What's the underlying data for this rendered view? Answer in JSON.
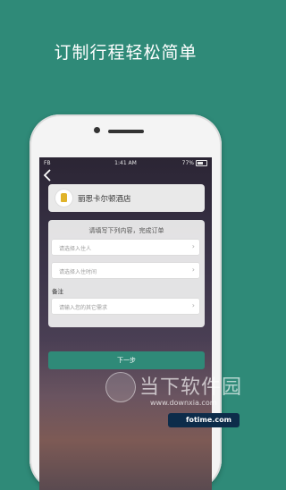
{
  "headline": "订制行程轻松简单",
  "status_bar": {
    "carrier": "FB",
    "time": "1:41 AM",
    "battery": "77%"
  },
  "hotel": {
    "name": "丽思卡尔顿酒店",
    "logo_icon": "hotel-logo-icon"
  },
  "form": {
    "title": "请填写下列内容，完成订单",
    "field_checkin_placeholder": "请选择入住人",
    "field_time_placeholder": "请选择入住时间",
    "remarks_label": "备注",
    "field_remarks_placeholder": "请输入您的其它需求"
  },
  "next_button": "下一步",
  "watermark": {
    "cn": "当下软件园",
    "site": "www.downxia.com",
    "brand": "fotime.com"
  },
  "colors": {
    "brand_green": "#2f8a78",
    "logo_gold": "#e0b32a"
  }
}
